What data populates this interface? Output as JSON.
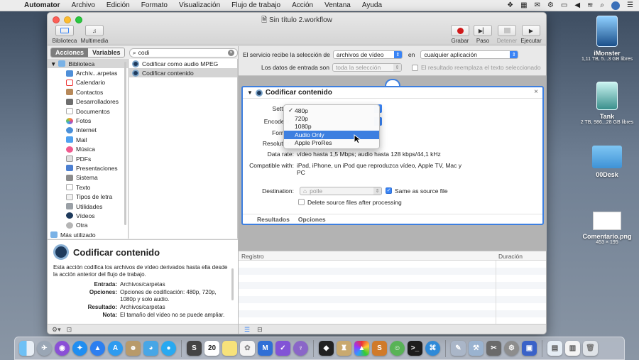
{
  "menubar": {
    "app": "Automator",
    "items": [
      "Archivo",
      "Edición",
      "Formato",
      "Visualización",
      "Flujo de trabajo",
      "Acción",
      "Ventana",
      "Ayuda"
    ]
  },
  "desktop": [
    {
      "name": "iMonster",
      "sub": "1,11 TB, 5...3 GB libres"
    },
    {
      "name": "Tank",
      "sub": "2 TB, 986...28 GB libres"
    },
    {
      "name": "00Desk",
      "sub": ""
    },
    {
      "name": "Comentario.png",
      "sub": "453 × 195"
    }
  ],
  "window": {
    "title": "Sin título 2.workflow",
    "toolbar_left": [
      {
        "label": "Biblioteca"
      },
      {
        "label": "Multimedia"
      }
    ],
    "toolbar_right": [
      {
        "label": "Grabar"
      },
      {
        "label": "Paso"
      },
      {
        "label": "Detener"
      },
      {
        "label": "Ejecutar"
      }
    ]
  },
  "left": {
    "seg_actions": "Acciones",
    "seg_variables": "Variables",
    "search_value": "codi",
    "library_root": "Biblioteca",
    "library": [
      "Archiv...arpetas",
      "Calendario",
      "Contactos",
      "Desarrolladores",
      "Documentos",
      "Fotos",
      "Internet",
      "Mail",
      "Música",
      "PDFs",
      "Presentaciones",
      "Sistema",
      "Texto",
      "Tipos de letra",
      "Utilidades",
      "Vídeos",
      "Otra"
    ],
    "library_more": "Más utilizado",
    "results": [
      "Codificar como audio MPEG",
      "Codificar contenido"
    ]
  },
  "description": {
    "title": "Codificar contenido",
    "text": "Esta acción codifica los archivos de vídeo derivados hasta ella desde la acción anterior del flujo de trabajo.",
    "rows": [
      {
        "k": "Entrada:",
        "v": "Archivos/carpetas"
      },
      {
        "k": "Opciones:",
        "v": "Opciones de codificación: 480p, 720p, 1080p y solo audio."
      },
      {
        "k": "Resultado:",
        "v": "Archivos/carpetas"
      },
      {
        "k": "Nota:",
        "v": "El tamaño del vídeo no se puede ampliar."
      }
    ]
  },
  "service": {
    "receives_label": "El servicio recibe la selección de",
    "receives_value": "archivos de vídeo",
    "in_label": "en",
    "in_value": "cualquier aplicación",
    "input_label": "Los datos de entrada son",
    "input_value": "toda la selección",
    "replace_label": "El resultado reemplaza el texto seleccionado"
  },
  "action": {
    "title": "Codificar contenido",
    "setting_label": "Setting",
    "encode_label": "Encode fo",
    "format_label": "Format",
    "resolution_label": "Resolution",
    "datarate_label": "Data rate:",
    "datarate_value": "vídeo hasta 1,5 Mbps; audio hasta 128 kbps/44,1 kHz",
    "compat_label": "Compatible with:",
    "compat_value": "iPad, iPhone, un iPod que reproduzca vídeo, Apple TV, Mac y PC",
    "dest_label": "Destination:",
    "dest_value": "polle",
    "same_as_source": "Same as source file",
    "delete_source": "Delete source files after processing",
    "tab_results": "Resultados",
    "tab_options": "Opciones"
  },
  "dropdown": {
    "items": [
      "480p",
      "720p",
      "1080p",
      "Audio Only",
      "Apple ProRes"
    ],
    "checked": "480p",
    "highlighted": "Audio Only"
  },
  "log": {
    "col_log": "Registro",
    "col_duration": "Duración"
  }
}
